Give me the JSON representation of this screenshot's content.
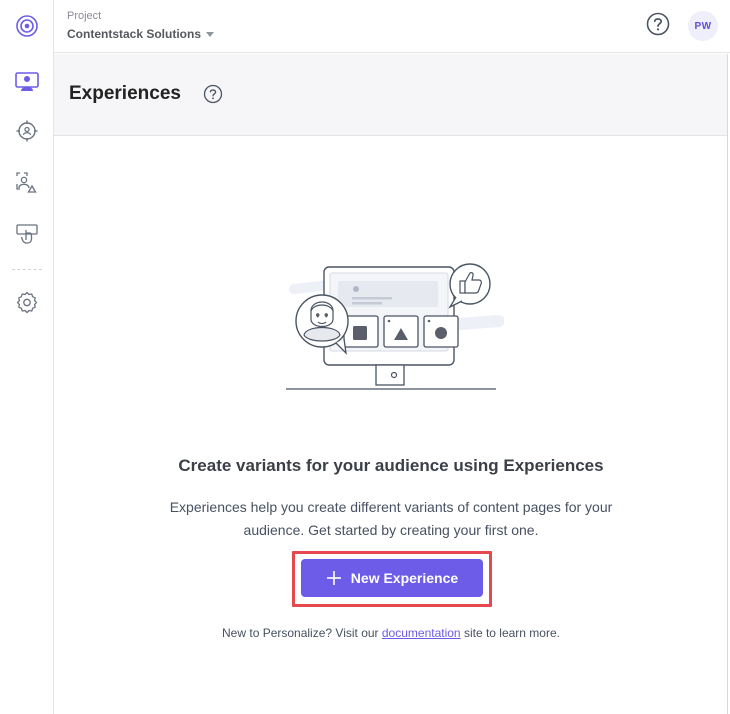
{
  "topbar": {
    "project_label": "Project",
    "project_name": "Contentstack Solutions",
    "avatar_initials": "PW"
  },
  "sidebar": {
    "items": [
      {
        "icon": "personalize-logo-icon",
        "active": false
      },
      {
        "icon": "experiences-icon",
        "active": true
      },
      {
        "icon": "audiences-icon",
        "active": false
      },
      {
        "icon": "attributes-icon",
        "active": false
      },
      {
        "icon": "events-icon",
        "active": false
      },
      {
        "icon": "settings-gear-icon",
        "active": false
      }
    ]
  },
  "page": {
    "title": "Experiences"
  },
  "empty_state": {
    "heading": "Create variants for your audience using Experiences",
    "description_line1": "Experiences help you create different variants of content pages for your",
    "description_line2": "audience. Get started by creating your first one.",
    "button_label": "New Experience",
    "footer_prefix": "New to Personalize? Visit our ",
    "footer_link": "documentation",
    "footer_suffix": " site to learn more."
  },
  "colors": {
    "accent": "#6c5ce7",
    "highlight": "#e5484d",
    "icon_gray": "#6b7280"
  }
}
